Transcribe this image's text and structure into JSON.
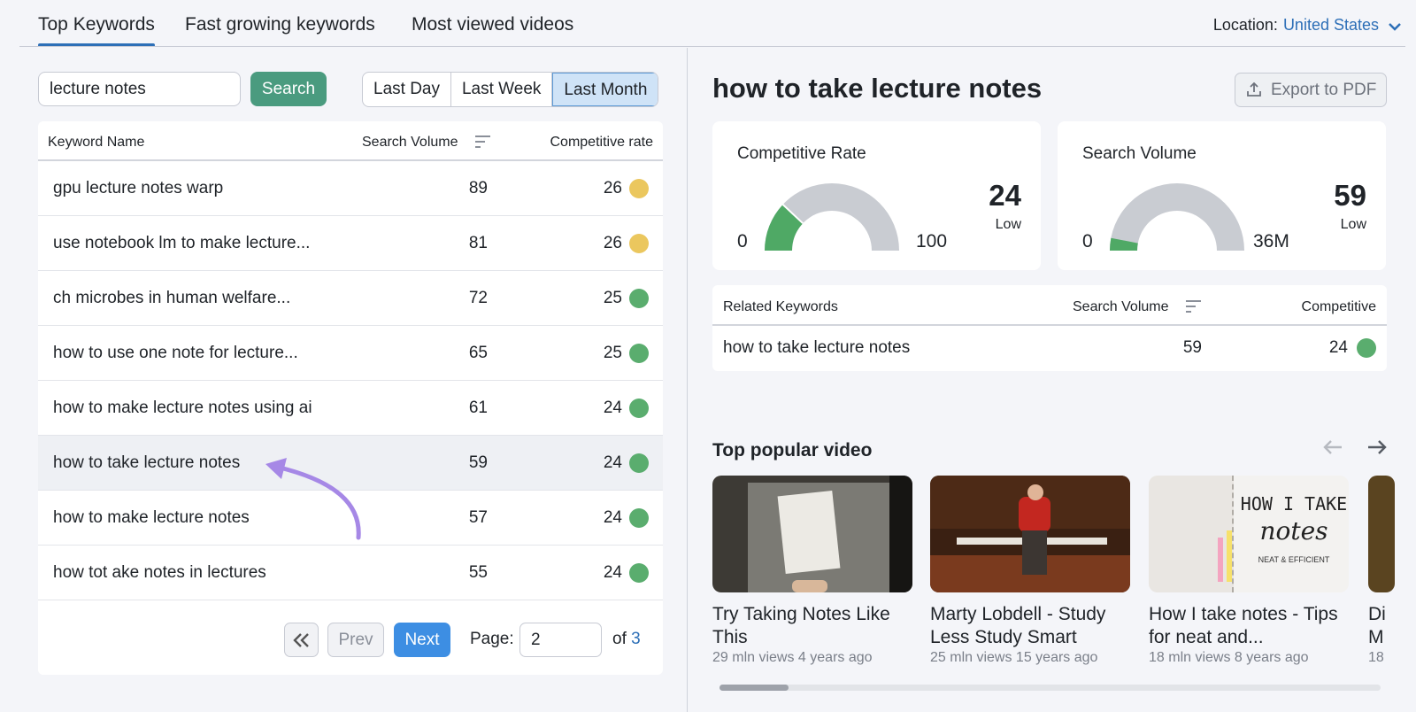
{
  "tabs": [
    "Top Keywords",
    "Fast growing keywords",
    "Most viewed videos"
  ],
  "location": {
    "label": "Location:",
    "value": "United States"
  },
  "search": {
    "value": "lecture notes",
    "button": "Search"
  },
  "periods": [
    "Last Day",
    "Last Week",
    "Last Month"
  ],
  "table": {
    "headers": [
      "Keyword Name",
      "Search Volume",
      "Competitive rate"
    ],
    "rows": [
      {
        "keyword": "gpu lecture notes warp",
        "volume": "89",
        "rate": "26",
        "color": "#ebc75e"
      },
      {
        "keyword": "use notebook lm to make lecture...",
        "volume": "81",
        "rate": "26",
        "color": "#ebc75e"
      },
      {
        "keyword": "ch microbes in human welfare...",
        "volume": "72",
        "rate": "25",
        "color": "#5aad6e"
      },
      {
        "keyword": "how to use one note for lecture...",
        "volume": "65",
        "rate": "25",
        "color": "#5aad6e"
      },
      {
        "keyword": "how to make lecture notes using ai",
        "volume": "61",
        "rate": "24",
        "color": "#5aad6e"
      },
      {
        "keyword": "how to take lecture notes",
        "volume": "59",
        "rate": "24",
        "color": "#5aad6e"
      },
      {
        "keyword": "how to make lecture notes",
        "volume": "57",
        "rate": "24",
        "color": "#5aad6e"
      },
      {
        "keyword": "how tot ake notes in lectures",
        "volume": "55",
        "rate": "24",
        "color": "#5aad6e"
      }
    ]
  },
  "pagination": {
    "prev": "Prev",
    "next": "Next",
    "page_label": "Page:",
    "page": "2",
    "of": "of",
    "total": "3"
  },
  "detail": {
    "title": "how to take lecture notes",
    "export": "Export to PDF",
    "competitive": {
      "title": "Competitive Rate",
      "min": "0",
      "max": "100",
      "value": "24",
      "level": "Low",
      "fraction": 0.24
    },
    "volume": {
      "title": "Search Volume",
      "min": "0",
      "max": "36M",
      "value": "59",
      "level": "Low",
      "fraction": 0.06
    },
    "related": {
      "headers": [
        "Related Keywords",
        "Search Volume",
        "Competitive"
      ],
      "rows": [
        {
          "keyword": "how to take lecture notes",
          "volume": "59",
          "rate": "24"
        }
      ]
    },
    "popular_title": "Top popular video",
    "videos": [
      {
        "title": "Try Taking Notes Like This",
        "meta": "29 mln views 4 years ago"
      },
      {
        "title": "Marty Lobdell - Study Less Study Smart",
        "meta": "25 mln views 15 years ago"
      },
      {
        "title": "How I take notes - Tips for neat and...",
        "meta": "18 mln views 8 years ago",
        "thumb_text1": "HOW I TAKE",
        "thumb_text2": "notes",
        "thumb_text3": "NEAT & EFFICIENT"
      },
      {
        "title": "Di M",
        "meta": "18"
      }
    ]
  }
}
